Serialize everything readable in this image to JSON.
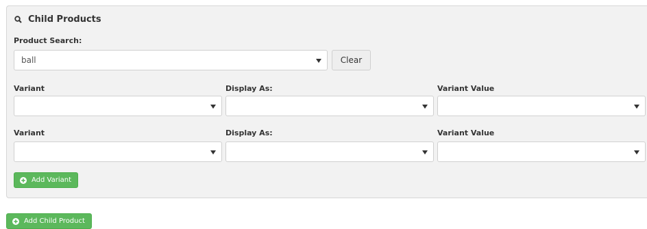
{
  "panel": {
    "title": "Child Products",
    "product_search": {
      "label": "Product Search:",
      "value": "ball",
      "clear_label": "Clear"
    },
    "variant_rows": [
      {
        "variant_label": "Variant",
        "display_as_label": "Display As:",
        "variant_value_label": "Variant Value",
        "variant_value": "",
        "display_as_value": "",
        "variant_value_value": ""
      },
      {
        "variant_label": "Variant",
        "display_as_label": "Display As:",
        "variant_value_label": "Variant Value",
        "variant_value": "",
        "display_as_value": "",
        "variant_value_value": ""
      }
    ],
    "add_variant_label": "Add Variant"
  },
  "add_child_product_label": "Add Child Product",
  "colors": {
    "accent_green": "#5cb85c",
    "panel_bg": "#f2f2f2"
  },
  "icons": {
    "title_icon": "search-icon",
    "add_icon": "plus-circle-icon",
    "dropdown_icon": "caret-down-icon"
  }
}
